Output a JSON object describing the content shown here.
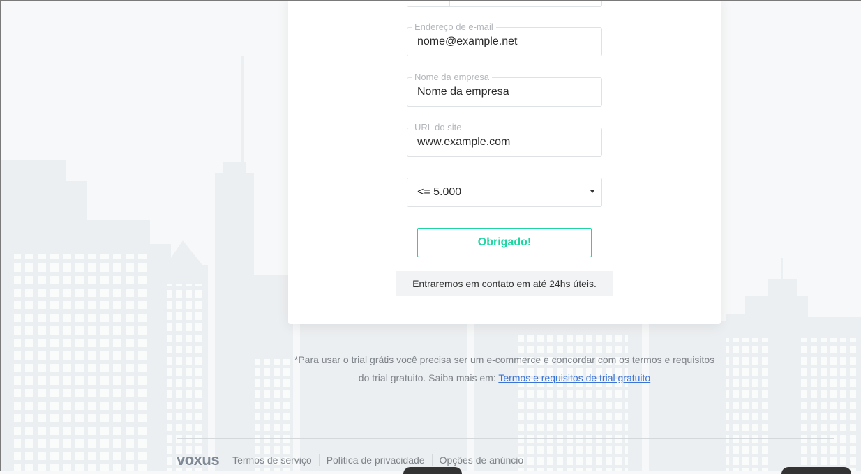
{
  "form": {
    "email": {
      "label": "Endereço de e-mail",
      "value": "nome@example.net"
    },
    "company": {
      "label": "Nome da empresa",
      "value": "Nome da empresa"
    },
    "site": {
      "label": "URL do site",
      "value": "www.example.com"
    },
    "volume": {
      "selected": "<= 5.000"
    },
    "submit_label": "Obrigado!",
    "notice": "Entraremos em contato em até 24hs úteis."
  },
  "trial": {
    "line1": "*Para usar o trial grátis você precisa ser um e-commerce e concordar com os termos e requisitos",
    "line2": "do trial gratuito. Saiba mais em: ",
    "link": "Termos e requisitos de trial gratuito"
  },
  "footer": {
    "logo": "voxus",
    "links": [
      "Termos de serviço",
      "Política de privacidade",
      "Opções de anúncio"
    ]
  },
  "colors": {
    "accent": "#1fd6a3",
    "link": "#3b73d6",
    "background": "#f7f8f9"
  }
}
